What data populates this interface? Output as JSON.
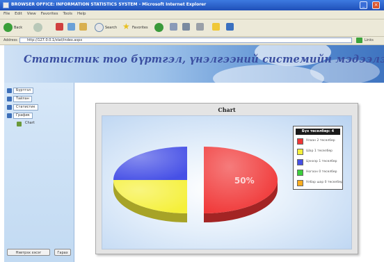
{
  "window": {
    "title": "BROWSER OFFICE: INFORMATION STATISTICS SYSTEM - Microsoft Internet Explorer",
    "min_glyph": "_",
    "close_glyph": "×"
  },
  "menu": [
    "File",
    "Edit",
    "View",
    "Favorites",
    "Tools",
    "Help"
  ],
  "toolbar": {
    "back_label": "Back",
    "search_label": "Search",
    "favorites_label": "Favorites"
  },
  "address": {
    "label": "Address",
    "value": "http://127.0.0.1/stat/index.aspx",
    "links_label": "Links"
  },
  "banner": {
    "title": "Статистик тоо бүртгэл, үнэлгээний системийн мэдээлэл"
  },
  "tree": {
    "items": [
      {
        "label": "Бүртгэл"
      },
      {
        "label": "Тайлан"
      },
      {
        "label": "Статистик"
      },
      {
        "label": "График"
      },
      {
        "label": "Chart"
      }
    ]
  },
  "bottom_buttons": {
    "primary": "Нэвтрэх хэсэг",
    "secondary": "Гарах"
  },
  "chart_data": {
    "type": "pie",
    "title": "Chart",
    "legend_title": "Бүх төсөлбөр: 4",
    "legend_placement": "top-right",
    "categories": [
      "Улаан 2 төсөлбөр",
      "Шар 1 төсөлбөр",
      "Цэнхэр 1 төсөлбөр",
      "Ногоон 0 төсөлбөр",
      "Улбар шар 0 төсөлбөр"
    ],
    "values": [
      50,
      25,
      25,
      0,
      0
    ],
    "value_labels": [
      "50%",
      "",
      "",
      "",
      ""
    ],
    "colors": [
      "#f03535",
      "#f5f03a",
      "#4650e6",
      "#3ccf3c",
      "#ffad1f"
    ]
  }
}
